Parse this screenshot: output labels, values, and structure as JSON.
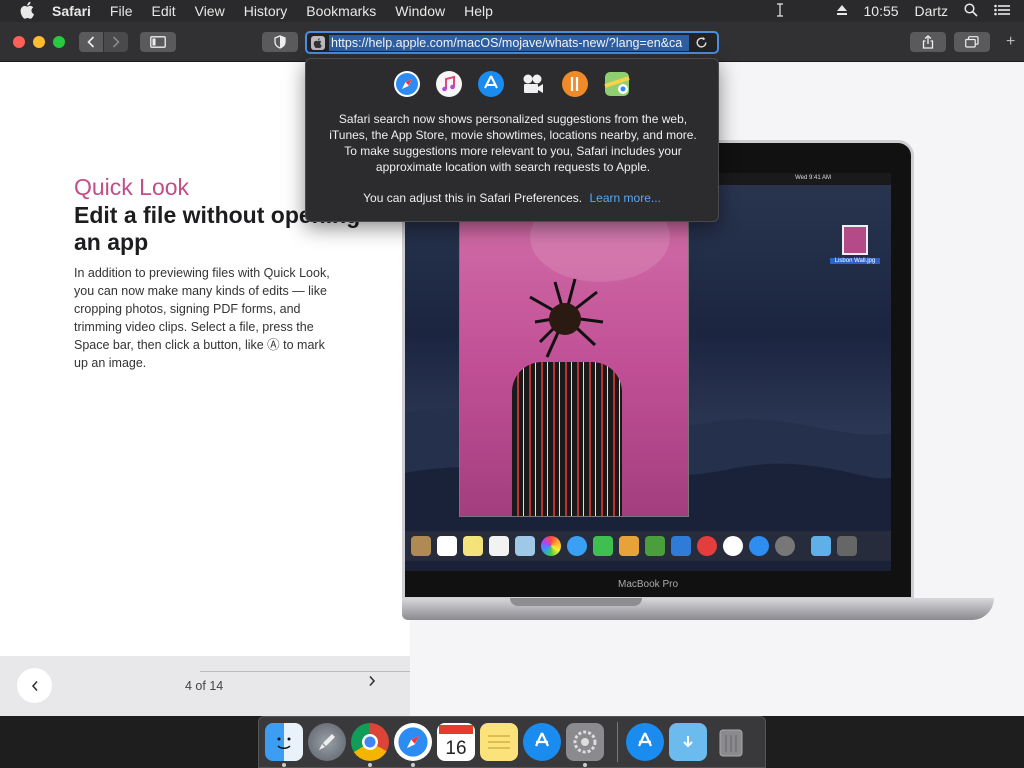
{
  "menubar": {
    "app": "Safari",
    "items": [
      "File",
      "Edit",
      "View",
      "History",
      "Bookmarks",
      "Window",
      "Help"
    ],
    "time": "10:55",
    "user": "Dartz"
  },
  "toolbar": {
    "url": "https://help.apple.com/macOS/mojave/whats-new/?lang=en&ca"
  },
  "popover": {
    "message": "Safari search now shows personalized suggestions from the web, iTunes, the App Store, movie showtimes, locations nearby, and more. To make suggestions more relevant to you, Safari includes your approximate location with search requests to Apple.",
    "adjust": "You can adjust this in Safari Preferences.",
    "learn_more": "Learn more..."
  },
  "content": {
    "subtitle": "Quick Look",
    "heading": "Edit a file without opening an app",
    "body": "In addition to previewing files with Quick Look, you can now make many kinds of edits — like cropping photos, signing PDF forms, and trimming video clips. Select a file, press the Space bar, then click a button, like Ⓐ to mark up an image."
  },
  "pager": {
    "count": "4 of 14"
  },
  "laptop": {
    "brand": "MacBook Pro",
    "file_label": "Lisbon Wall.jpg",
    "mini_time": "Wed 9:41 AM"
  },
  "colors": {
    "accent_pink": "#c24d87",
    "link_blue": "#5aa7f2",
    "url_highlight": "#2e5fa3"
  }
}
